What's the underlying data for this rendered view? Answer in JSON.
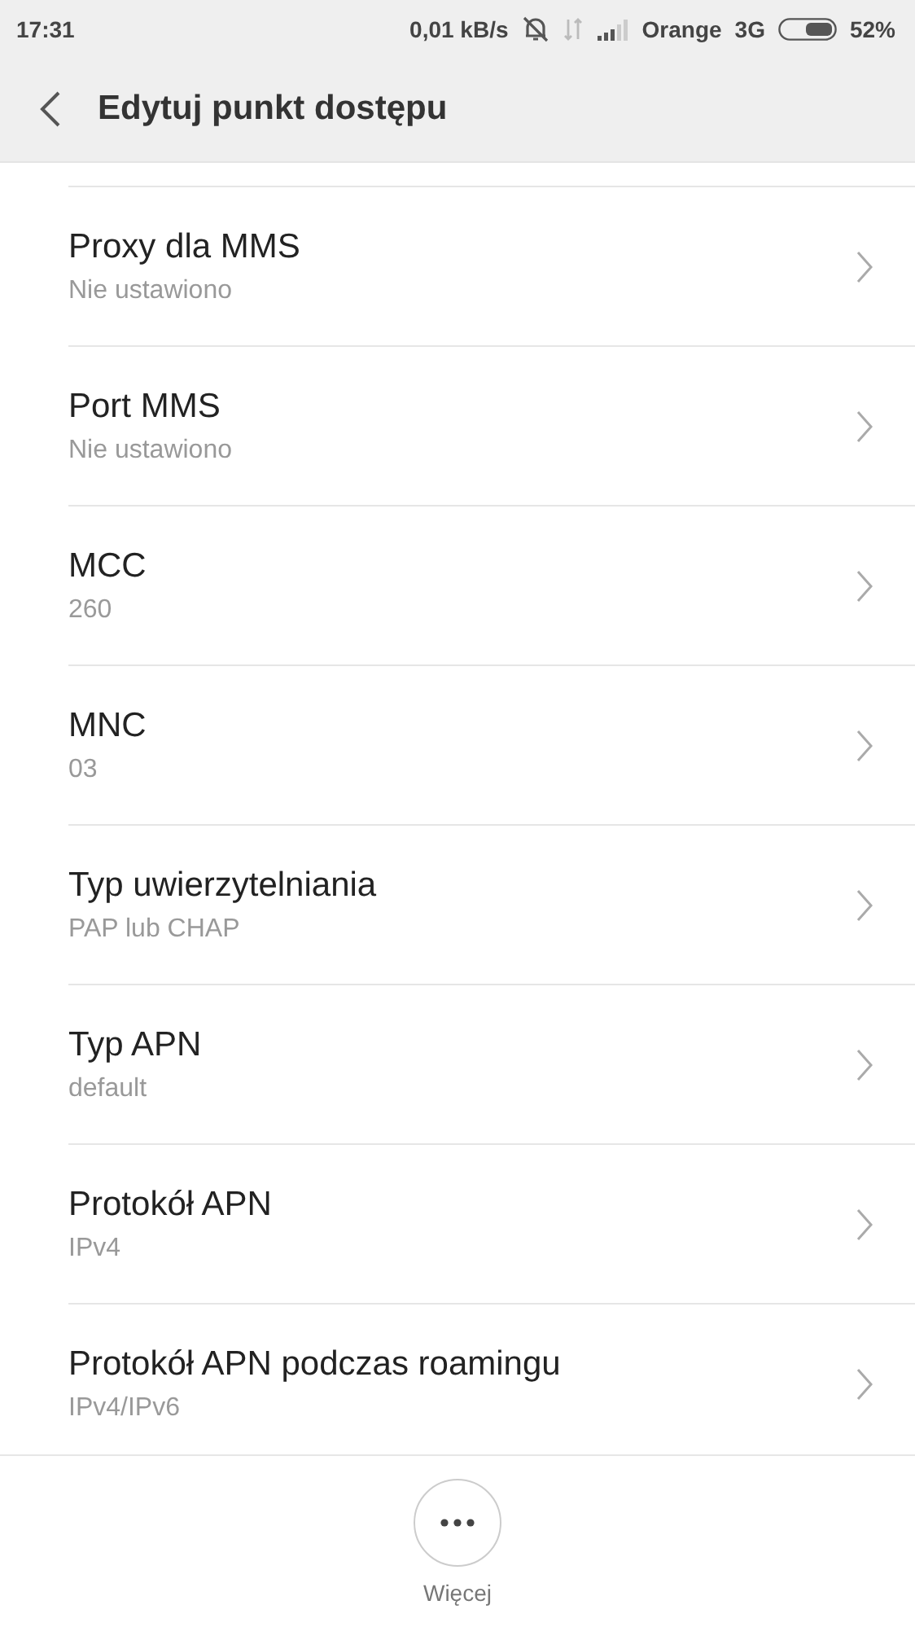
{
  "status_bar": {
    "time": "17:31",
    "speed": "0,01 kB/s",
    "carrier": "Orange",
    "network": "3G",
    "battery": "52%"
  },
  "header": {
    "title": "Edytuj punkt dostępu"
  },
  "items": [
    {
      "title": "Proxy dla MMS",
      "value": "Nie ustawiono"
    },
    {
      "title": "Port MMS",
      "value": "Nie ustawiono"
    },
    {
      "title": "MCC",
      "value": "260"
    },
    {
      "title": "MNC",
      "value": "03"
    },
    {
      "title": "Typ uwierzytelniania",
      "value": "PAP lub CHAP"
    },
    {
      "title": "Typ APN",
      "value": "default"
    },
    {
      "title": "Protokół APN",
      "value": "IPv4"
    },
    {
      "title": "Protokół APN podczas roamingu",
      "value": "IPv4/IPv6"
    }
  ],
  "bottom_bar": {
    "label": "Więcej"
  }
}
